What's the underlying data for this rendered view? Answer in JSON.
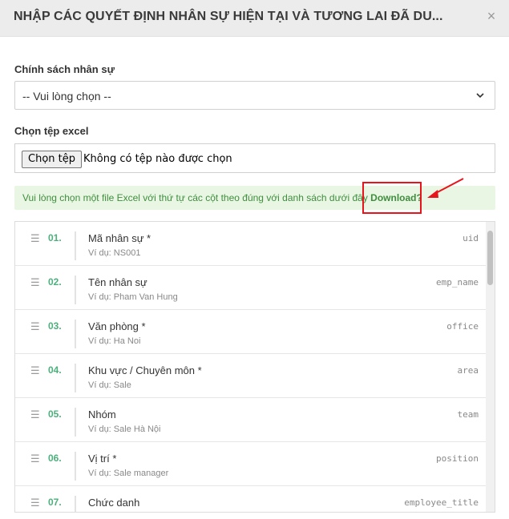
{
  "dialog": {
    "title": "NHẬP CÁC QUYẾT ĐỊNH NHÂN SỰ HIỆN TẠI VÀ TƯƠNG LAI ĐÃ DU...",
    "close_symbol": "×"
  },
  "policy": {
    "label": "Chính sách nhân sự",
    "selected": "-- Vui lòng chọn --"
  },
  "file": {
    "label": "Chọn tệp excel",
    "button_label": "Chọn tệp",
    "status": "Không có tệp nào được chọn"
  },
  "notice": {
    "text": "Vui lòng chọn một file Excel với thứ tự các cột theo đúng với danh sách dưới đây",
    "link_label": "Download?"
  },
  "annotation": {
    "highlight_color": "#e8131b"
  },
  "columns": [
    {
      "num": "01.",
      "name": "Mã nhân sự *",
      "example": "Ví dụ: NS001",
      "key": "uid"
    },
    {
      "num": "02.",
      "name": "Tên nhân sự",
      "example": "Ví dụ: Pham Van Hung",
      "key": "emp_name"
    },
    {
      "num": "03.",
      "name": "Văn phòng *",
      "example": "Ví dụ: Ha Noi",
      "key": "office"
    },
    {
      "num": "04.",
      "name": "Khu vực / Chuyên môn *",
      "example": "Ví dụ: Sale",
      "key": "area"
    },
    {
      "num": "05.",
      "name": "Nhóm",
      "example": "Ví dụ: Sale Hà Nội",
      "key": "team"
    },
    {
      "num": "06.",
      "name": "Vị trí *",
      "example": "Ví dụ: Sale manager",
      "key": "position"
    },
    {
      "num": "07.",
      "name": "Chức danh",
      "example": "",
      "key": "employee_title"
    }
  ],
  "icons": {
    "drag": "drag-handle-icon",
    "chevron": "chevron-down-icon",
    "close": "close-icon"
  },
  "colors": {
    "number_green": "#4caf7c",
    "notice_bg": "#eaf6e4",
    "notice_text": "#3e8e3e"
  }
}
